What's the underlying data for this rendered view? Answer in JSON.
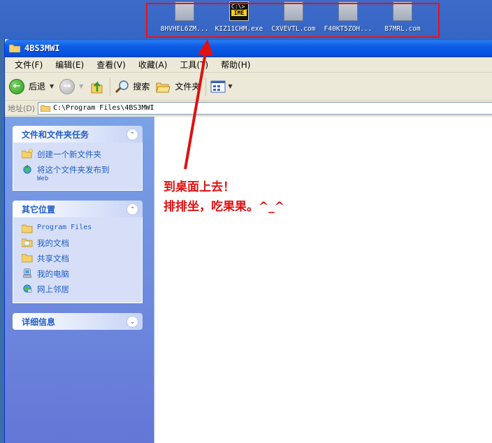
{
  "desktop": {
    "icons": [
      {
        "label": "8HVHEL6ZM...",
        "type": "generic"
      },
      {
        "label": "KIZ11CHM.exe",
        "type": "ime"
      },
      {
        "label": "CXVEVTL.com",
        "type": "generic"
      },
      {
        "label": "F40KT5ZOH...",
        "type": "generic"
      },
      {
        "label": "B7MRL.com",
        "type": "generic"
      }
    ],
    "ime_icon": {
      "line1": "C:\\>_",
      "label": "IME"
    }
  },
  "window": {
    "title": "4BS3MWI",
    "menu": [
      "文件(F)",
      "编辑(E)",
      "查看(V)",
      "收藏(A)",
      "工具(T)",
      "帮助(H)"
    ],
    "toolbar": {
      "back": "后退",
      "search": "搜索",
      "folders": "文件夹"
    },
    "address": {
      "label": "地址(D)",
      "path": "C:\\Program Files\\4BS3MWI"
    }
  },
  "taskpane": {
    "panels": [
      {
        "title": "文件和文件夹任务",
        "links": [
          {
            "text": "创建一个新文件夹",
            "icon": "new-folder-icon"
          },
          {
            "text": "将这个文件夹发布到",
            "sub": "Web",
            "icon": "publish-web-icon"
          }
        ]
      },
      {
        "title": "其它位置",
        "links": [
          {
            "text": "Program Files",
            "icon": "folder-icon",
            "mono": true
          },
          {
            "text": "我的文档",
            "icon": "my-documents-icon"
          },
          {
            "text": "共享文档",
            "icon": "shared-folder-icon"
          },
          {
            "text": "我的电脑",
            "icon": "my-computer-icon"
          },
          {
            "text": "网上邻居",
            "icon": "network-icon"
          }
        ]
      },
      {
        "title": "详细信息",
        "links": []
      }
    ]
  },
  "annotation": {
    "line1": "到桌面上去！",
    "line2": "排排坐，吃果果。^_^"
  },
  "colors": {
    "annotation": "#e01010",
    "highlight": "#e11111"
  }
}
